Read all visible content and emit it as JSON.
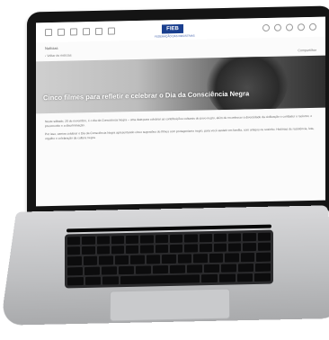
{
  "header": {
    "logo_text": "FIEB",
    "logo_subtitle": "FEDERAÇÃO DAS INDÚSTRIAS"
  },
  "subnav": {
    "label": "Notícias"
  },
  "breadcrumb": "‹ Voltar às notícias",
  "share_label": "Compartilhar",
  "hero": {
    "title": "Cinco filmes para refletir e celebrar o Dia da Consciência Negra"
  },
  "article": {
    "paragraph1": "Neste sábado, 20 de novembro, é o dia da Consciência Negra – uma data para celebrar as contribuições culturais do povo negro, além de reconhecer a diversidade da civilização e combater o racismo, o preconceito e a discriminação.",
    "paragraph2": "Por isso, vamos celebrar o Dia da Consciência Negra apresentando cinco sugestões de filmes com protagonismo negro, para você assistir em família, com amigos ou sozinho. Histórias de resistência, luta, orgulho e celebração da cultura negra."
  },
  "colors": {
    "brand": "#1a3f8f",
    "hero_text": "#ffffff"
  }
}
